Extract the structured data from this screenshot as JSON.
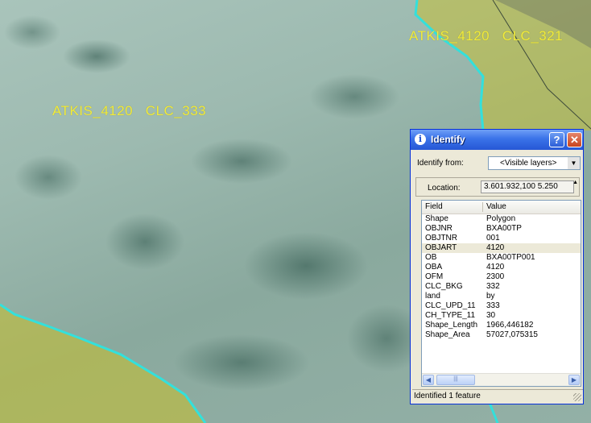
{
  "map": {
    "labels": [
      {
        "text": "ATKIS_4120   CLC_333"
      },
      {
        "text": "ATKIS_4120   CLC_321"
      }
    ]
  },
  "identify": {
    "title": "Identify",
    "identify_from_label": "Identify from:",
    "identify_from_value": "<Visible layers>",
    "location_label": "Location:",
    "location_value": "3.601.932,100  5.250",
    "columns": [
      "Field",
      "Value"
    ],
    "rows": [
      {
        "field": "Shape",
        "value": "Polygon"
      },
      {
        "field": "OBJNR",
        "value": "BXA00TP"
      },
      {
        "field": "OBJTNR",
        "value": "001"
      },
      {
        "field": "OBJART",
        "value": "4120"
      },
      {
        "field": "OB",
        "value": "BXA00TP001"
      },
      {
        "field": "OBA",
        "value": "4120"
      },
      {
        "field": "OFM",
        "value": "2300"
      },
      {
        "field": "CLC_BKG",
        "value": "332"
      },
      {
        "field": "land",
        "value": "by"
      },
      {
        "field": "CLC_UPD_11",
        "value": "333"
      },
      {
        "field": "CH_TYPE_11",
        "value": "30"
      },
      {
        "field": "Shape_Length",
        "value": "1966,446182"
      },
      {
        "field": "Shape_Area",
        "value": "57027,075315"
      }
    ],
    "selected_row": 3,
    "status": "Identified 1 feature"
  },
  "colors": {
    "boundary": "#33e0dc",
    "label": "#f2ec3a",
    "yellow_polygon": "#c9c02a",
    "titlebar": "#2a5fd8"
  }
}
